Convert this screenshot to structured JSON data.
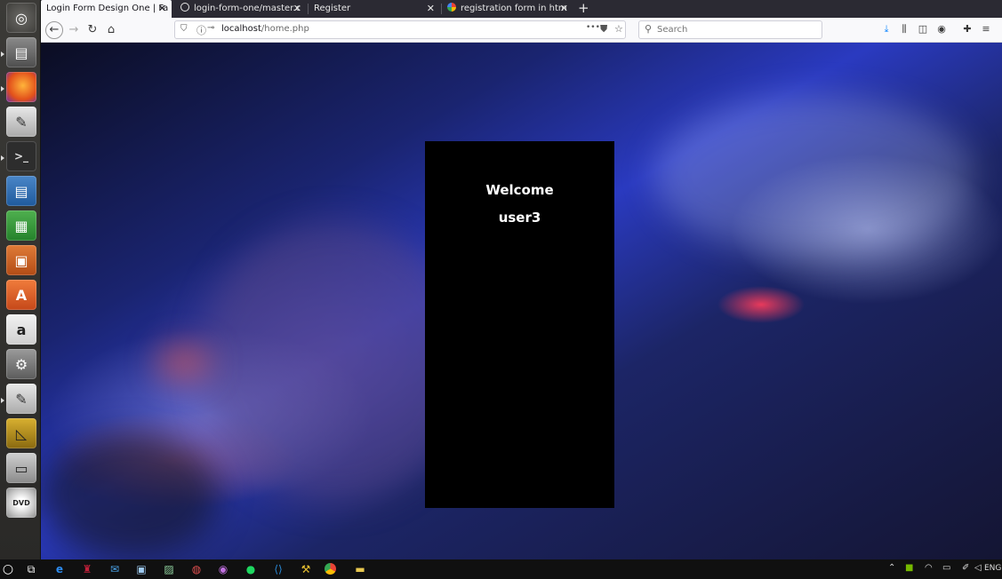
{
  "browser": {
    "tabs": [
      {
        "title": "Login Form Design One | Fa",
        "active": true
      },
      {
        "title": "login-form-one/master.c",
        "active": false
      },
      {
        "title": "Register",
        "active": false
      },
      {
        "title": "registration form in htm",
        "active": false
      }
    ],
    "new_tab_label": "+",
    "url_host": "localhost",
    "url_path": "/home.php",
    "search_placeholder": "Search",
    "page_actions": "•••"
  },
  "page": {
    "welcome_text": "Welcome",
    "username": "user3"
  },
  "launcher": {
    "apps": [
      "ubuntu-dash",
      "file-manager",
      "firefox",
      "text-editor",
      "terminal",
      "writer",
      "calc",
      "impress",
      "software-center",
      "amazon",
      "system-settings",
      "text-editor-2",
      "geometry-app",
      "floppy-drive",
      "dvd-drive"
    ]
  },
  "taskbar": {
    "language": "ENG"
  },
  "colors": {
    "accent": "#0a84ff",
    "panel": "#000000"
  }
}
